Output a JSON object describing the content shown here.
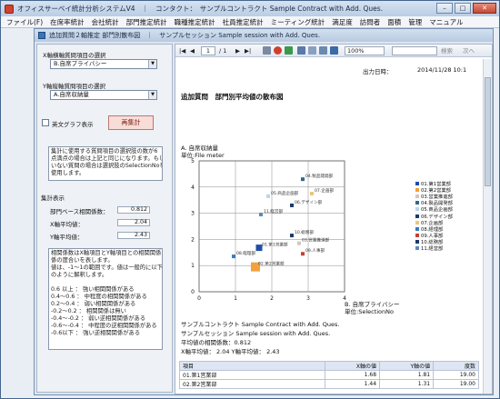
{
  "app": {
    "title": "オフィスサーベイ統計分析システムV4　｜　コンタクト：　サンプルコントラクト Sample Contract with Add. Ques."
  },
  "window_buttons": {
    "minimize": "–",
    "maximize": "□",
    "close": "✕"
  },
  "menu": [
    "ファイル(F)",
    "在席率統計",
    "会社統計",
    "部門推定統計",
    "職種推定統計",
    "社員推定統計",
    "ミーティング統計",
    "満足度",
    "訪問者",
    "面積",
    "管理",
    "マニュアル"
  ],
  "subwindow": {
    "title": "追加質問２軸推定 部門別散布図　｜　サンプルセッション Sample session with Add. Ques."
  },
  "left": {
    "x_label": "X軸横軸質問項目の選択",
    "x_value": "B.自席プライバシー",
    "y_label": "Y軸縦軸質問項目の選択",
    "y_value": "A.自席収納量",
    "checkbox_label": "英文グラフ表示",
    "recalc": "再集計",
    "note": [
      "集計に使用する質問項目の選択肢の数が6",
      "点満点の場合は上記と同じになります。もし、",
      "いない質問の場合は選択肢のSelectionNoを",
      "使用します。"
    ],
    "stats_header": "集計表示",
    "stat_rows": [
      {
        "label": "部門ベース相関係数：",
        "value": "0.812"
      },
      {
        "label": "X軸平均値：",
        "value": "2.04"
      },
      {
        "label": "Y軸平均値：",
        "value": "2.43"
      }
    ],
    "corr_text": [
      "相関係数はX軸項目とY軸項目との相関関係",
      "係の度合いを表します。",
      "値は、-1～1の範囲です。値は一般的に以下",
      "のように解釈します。",
      "",
      "0.6 以上 ： 強い相関関係がある",
      "0.4～0.6 ： 中程度の相関関係がある",
      "0.2～0.4 ： 弱い相関関係がある",
      "-0.2～0.2 ： 相関関係は無い",
      "-0.4～-0.2 ： 弱い逆相関関係がある",
      "-0.6～-0.4 ： 中程度の逆相関関係がある",
      "-0.6以下 ： 強い逆相関関係がある"
    ]
  },
  "toolbar": {
    "page": "1",
    "of": "/ 1",
    "zoom": "100%",
    "search": "検索",
    "next": "次へ"
  },
  "report": {
    "output_date_label": "出力日時：",
    "output_date": "2014/11/28 10:1",
    "title": "追加質問　部門別平均値の散布図",
    "axis_y_name": "A. 自席収納量",
    "axis_y_unit": "単位:File meter",
    "axis_x_name": "B. 自席プライバシー",
    "axis_x_unit": "単位:SelectionNo",
    "contract": "サンプルコントラクト Sample Contract with Add. Ques.",
    "session": "サンプルセッション Sample session with Add. Ques.",
    "corr": "平均値の相関係数：0.812",
    "means": "X軸平均値：  2.04    Y軸平均値：  2.43"
  },
  "chart_data": {
    "type": "scatter",
    "xlim": [
      0,
      4
    ],
    "ylim": [
      0,
      5
    ],
    "xticks": [
      "0",
      "1",
      "2",
      "3",
      "4"
    ],
    "yticks": [
      "0",
      "1",
      "2",
      "3",
      "4",
      "5"
    ],
    "points": [
      {
        "label": "01.第1営業部",
        "x": 1.65,
        "y": 1.68,
        "color": "#1f4ea8"
      },
      {
        "label": "02.第2営業部",
        "x": 1.55,
        "y": 0.95,
        "color": "#f2a23a"
      },
      {
        "label": "03.営業推進部",
        "x": 2.75,
        "y": 1.85,
        "color": "#d0c8c0"
      },
      {
        "label": "04.製品開発部",
        "x": 2.85,
        "y": 4.3,
        "color": "#2e6b8a"
      },
      {
        "label": "05.商品企画部",
        "x": 1.9,
        "y": 3.65,
        "color": "#bfd4ea"
      },
      {
        "label": "06.デザイン部",
        "x": 2.55,
        "y": 3.3,
        "color": "#1c3a66"
      },
      {
        "label": "07.企画部",
        "x": 3.1,
        "y": 3.75,
        "color": "#e8c880"
      },
      {
        "label": "08.経理部",
        "x": 0.95,
        "y": 1.35,
        "color": "#3a7ac0"
      },
      {
        "label": "09.人事部",
        "x": 2.85,
        "y": 1.45,
        "color": "#c84030"
      },
      {
        "label": "10.総務部",
        "x": 2.55,
        "y": 2.15,
        "color": "#1a3a6a"
      },
      {
        "label": "11.経営部",
        "x": 1.7,
        "y": 2.95,
        "color": "#5e88b8"
      }
    ],
    "legend_placement": "right",
    "grid": true
  },
  "table": {
    "headers": [
      "項目",
      "X軸の値",
      "Y軸の値",
      "度数"
    ],
    "rows": [
      [
        "01.第1営業部",
        "1.68",
        "1.81",
        "19.00"
      ],
      [
        "02.第2営業部",
        "1.44",
        "1.31",
        "19.00"
      ]
    ]
  }
}
